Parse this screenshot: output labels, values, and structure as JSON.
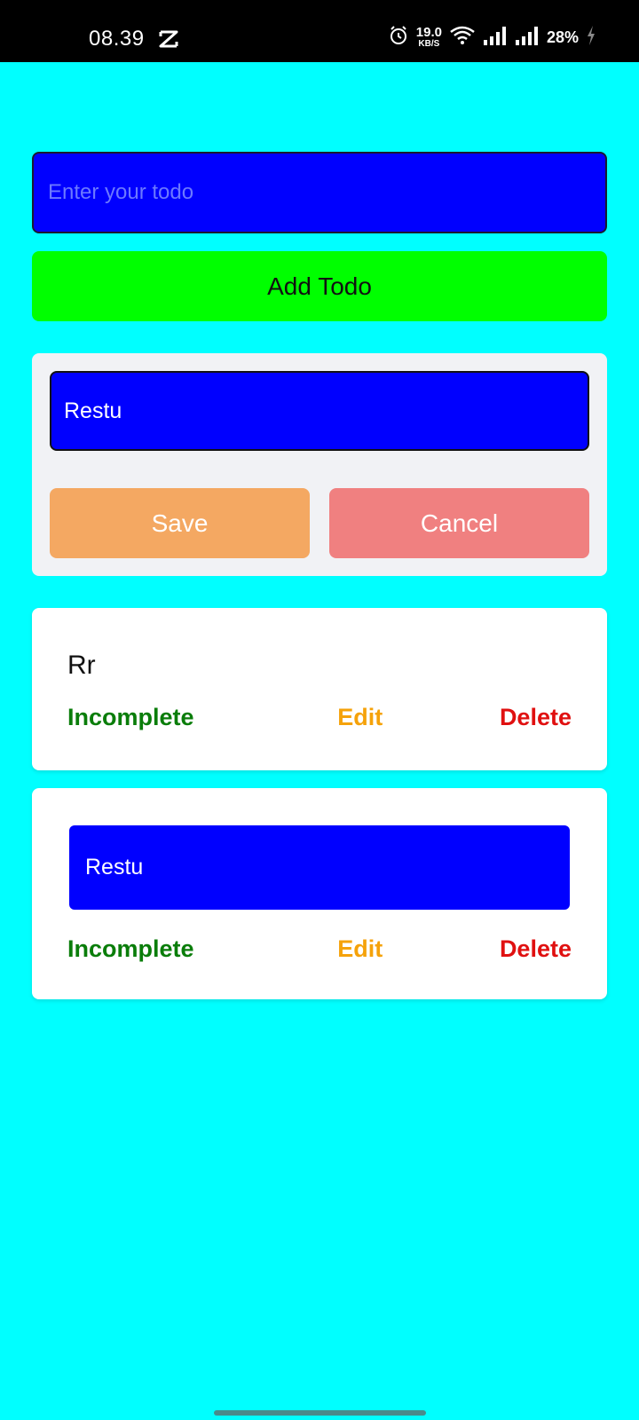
{
  "status_bar": {
    "time": "08.39",
    "network_speed": "19.0",
    "network_speed_unit": "KB/S",
    "battery": "28%",
    "icons": [
      "capcut-icon",
      "alarm-icon",
      "wifi-icon",
      "signal-icon",
      "signal-icon",
      "charging-icon"
    ]
  },
  "new_todo": {
    "placeholder": "Enter your todo",
    "value": "",
    "add_label": "Add Todo"
  },
  "edit_panel": {
    "value": "Restu",
    "save_label": "Save",
    "cancel_label": "Cancel"
  },
  "todos": [
    {
      "text": "Rr",
      "status_label": "Incomplete",
      "edit_label": "Edit",
      "delete_label": "Delete"
    },
    {
      "text": "Restu",
      "status_label": "Incomplete",
      "edit_label": "Edit",
      "delete_label": "Delete"
    }
  ],
  "colors": {
    "background": "#00ffff",
    "input": "#0000ff",
    "add_button": "#00ff00",
    "save_button": "#f4a862",
    "cancel_button": "#f08080",
    "incomplete": "#0a7d0a",
    "edit": "#f5a20a",
    "delete": "#e01010"
  }
}
